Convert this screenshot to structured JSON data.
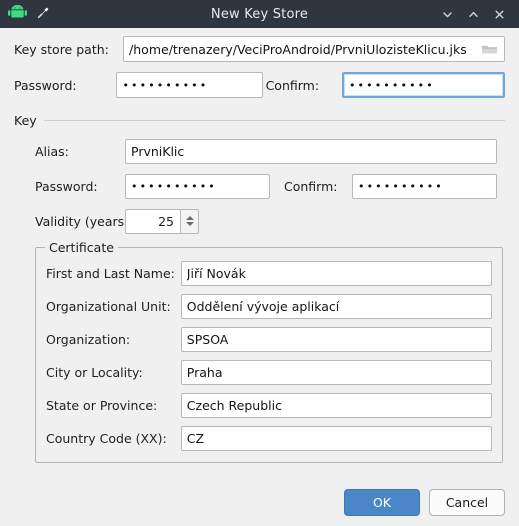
{
  "window": {
    "title": "New Key Store",
    "app_icon": "android-robot-icon",
    "pin_icon": "pin-icon",
    "controls": [
      {
        "name": "minimize-button",
        "icon": "chevron-down-icon"
      },
      {
        "name": "maximize-button",
        "icon": "chevron-up-icon"
      },
      {
        "name": "close-button",
        "icon": "close-icon"
      }
    ],
    "titlebar_color": "#2f3640",
    "background_color": "#f0f0f0"
  },
  "keystore": {
    "path_label": "Key store path:",
    "path_value": "/home/trenazery/VeciProAndroid/PrvniUlozisteKlicu.jks",
    "browse_icon": "folder-icon",
    "password_label": "Password:",
    "password_value": "••••••••••",
    "confirm_label": "Confirm:",
    "confirm_value": "••••••••••"
  },
  "key": {
    "section_label": "Key",
    "alias_label": "Alias:",
    "alias_value": "PrvniKlic",
    "password_label": "Password:",
    "password_value": "••••••••••",
    "confirm_label": "Confirm:",
    "confirm_value": "••••••••••",
    "validity_label": "Validity (years):",
    "validity_value": "25"
  },
  "certificate": {
    "group_label": "Certificate",
    "fields": [
      {
        "label": "First and Last Name:",
        "value": "Jiří Novák",
        "name": "first-and-last-name"
      },
      {
        "label": "Organizational Unit:",
        "value": "Oddělení vývoje aplikací",
        "name": "organizational-unit"
      },
      {
        "label": "Organization:",
        "value": "SPSOA",
        "name": "organization"
      },
      {
        "label": "City or Locality:",
        "value": "Praha",
        "name": "city-or-locality"
      },
      {
        "label": "State or Province:",
        "value": "Czech Republic",
        "name": "state-or-province"
      },
      {
        "label": "Country Code (XX):",
        "value": "CZ",
        "name": "country-code"
      }
    ]
  },
  "buttons": {
    "ok_label": "OK",
    "cancel_label": "Cancel",
    "ok_color": "#4a86c8"
  }
}
